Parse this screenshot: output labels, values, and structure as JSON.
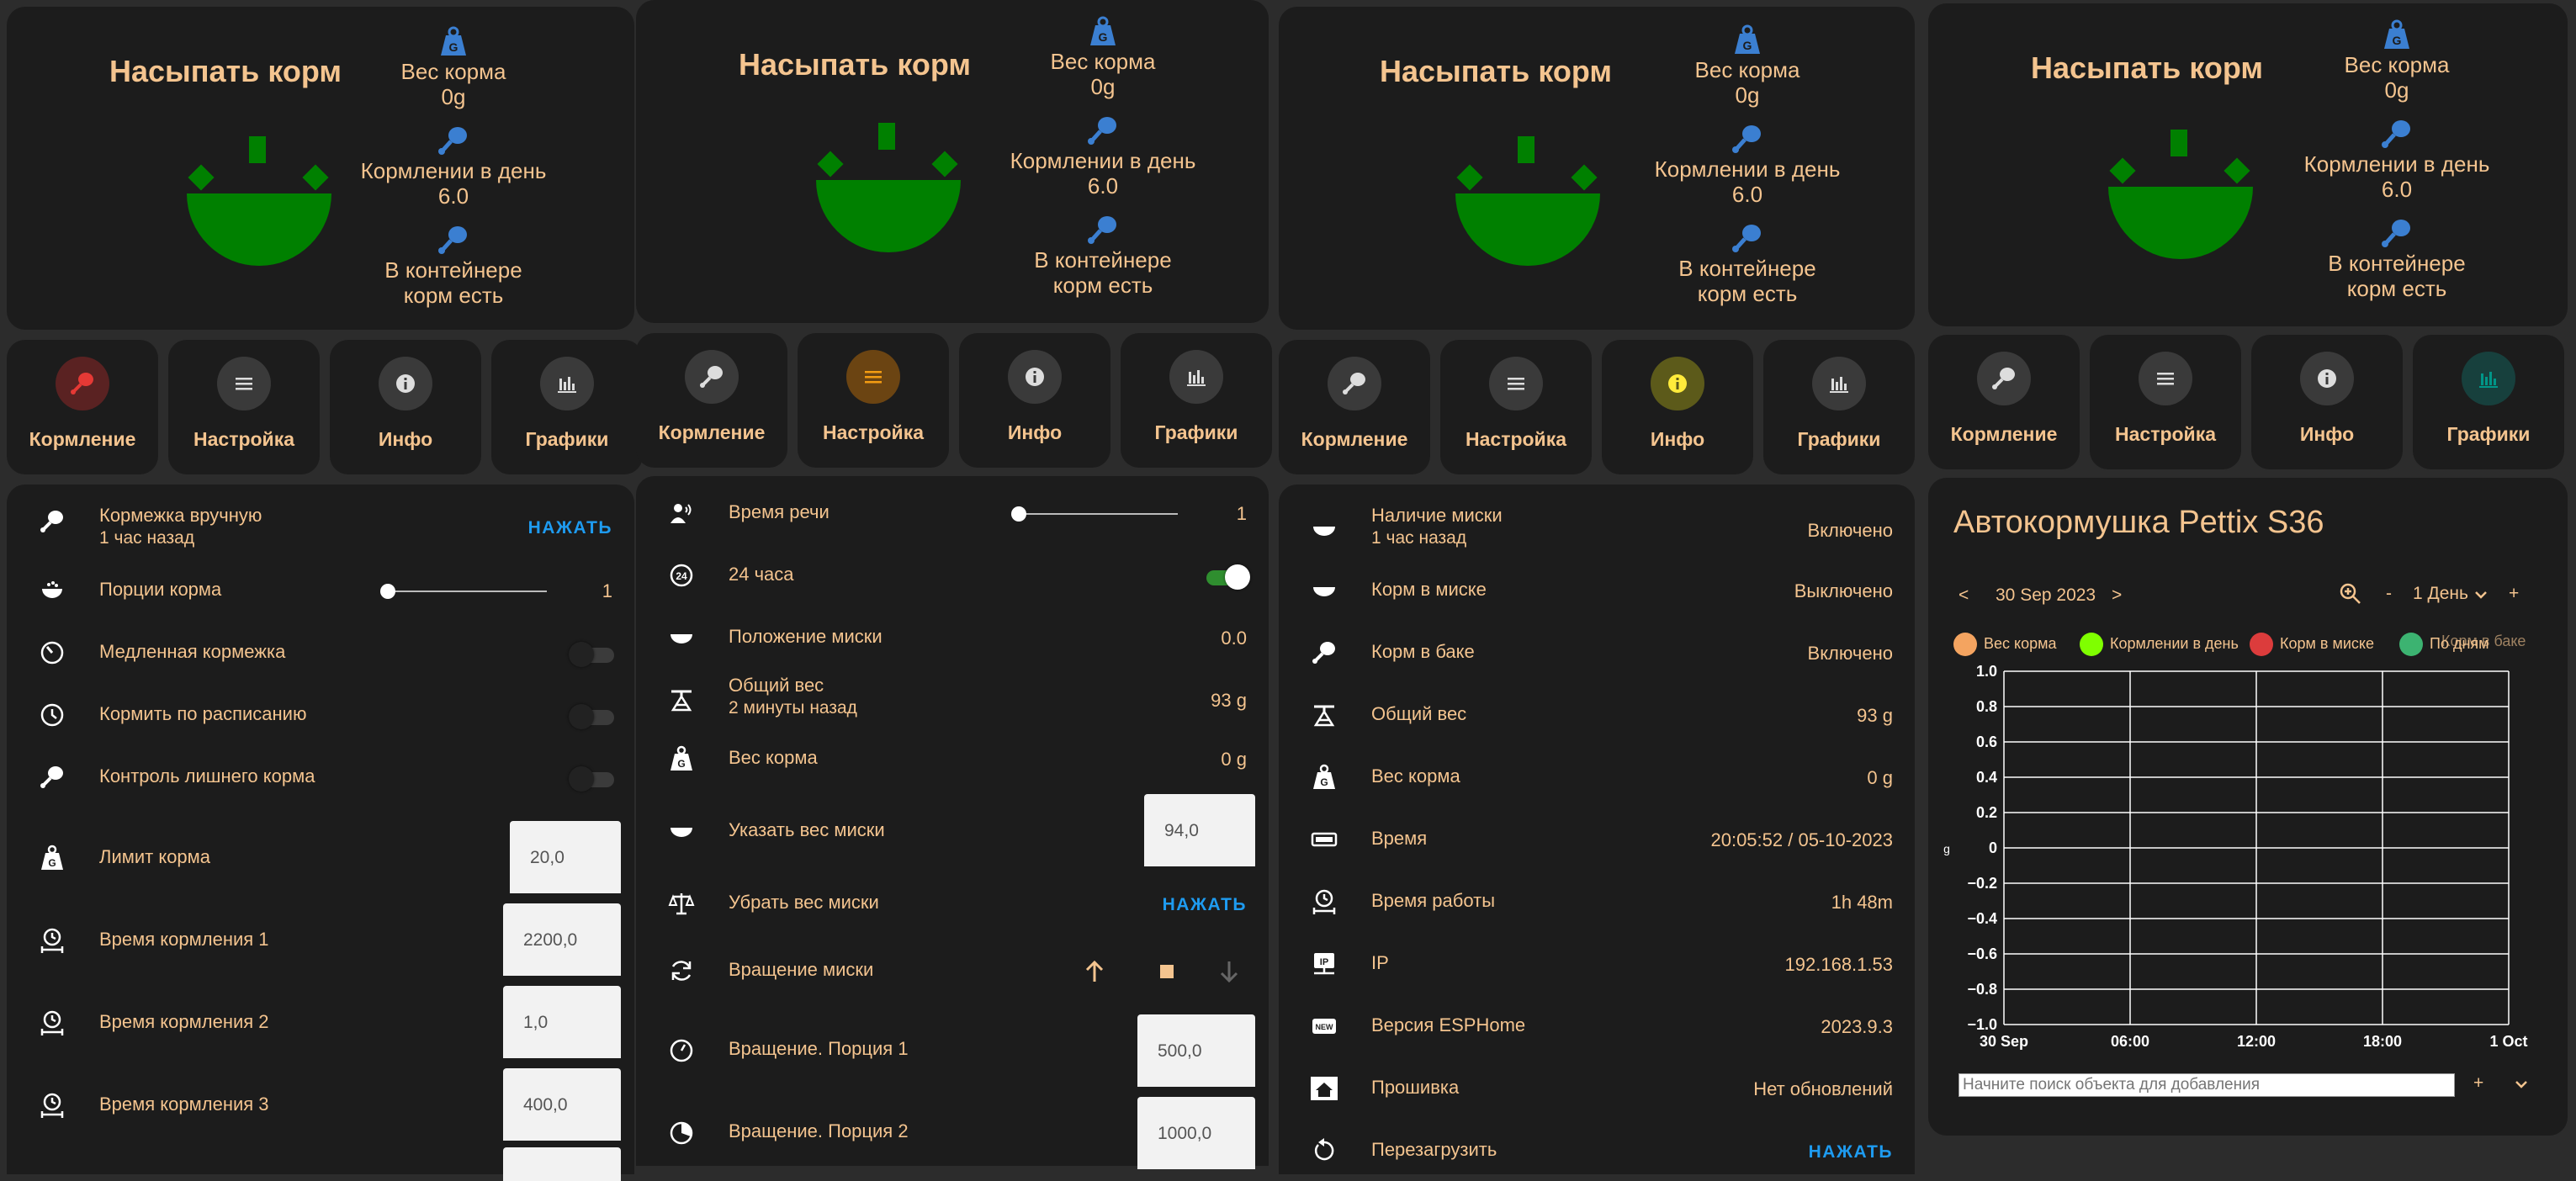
{
  "colors": {
    "accent": "#f4c48f",
    "card": "#1c1c1c",
    "bg": "#2c2c2c",
    "green": "#008000",
    "blue": "#1e9bf0",
    "icon_blue": "#3b7fd1"
  },
  "hero": {
    "title": "Насыпать корм",
    "stat1_label": "Вес корма",
    "stat1_value": "0g",
    "stat2_label": "Кормлении в день",
    "stat2_value": "6.0",
    "stat3_label": "В контейнере",
    "stat3_value": "корм есть"
  },
  "tabs": [
    "Кормление",
    "Настройка",
    "Инфо",
    "Графики"
  ],
  "feeding": {
    "manual_label": "Кормежка вручную",
    "manual_time": "1 час назад",
    "press": "НАЖАТЬ",
    "portions_label": "Порции корма",
    "portions_value": "1",
    "slow_label": "Медленная кормежка",
    "schedule_label": "Кормить по расписанию",
    "excess_label": "Контроль лишнего корма",
    "limit_label": "Лимит корма",
    "limit_value": "20,0",
    "time1_label": "Время кормления 1",
    "time1_value": "2200,0",
    "time2_label": "Время кормления 2",
    "time2_value": "1,0",
    "time3_label": "Время кормления 3",
    "time3_value": "400,0"
  },
  "settings": {
    "speech_label": "Время речи",
    "speech_value": "1",
    "h24_label": "24 часа",
    "bowl_pos_label": "Положение миски",
    "bowl_pos_value": "0.0",
    "total_label": "Общий вес",
    "total_time": "2 минуты назад",
    "total_value": "93 g",
    "feed_weight_label": "Вес корма",
    "feed_weight_value": "0 g",
    "set_bowl_label": "Указать вес миски",
    "set_bowl_value": "94,0",
    "remove_bowl_label": "Убрать вес миски",
    "press": "НАЖАТЬ",
    "rotate_label": "Вращение миски",
    "rot1_label": "Вращение. Порция 1",
    "rot1_value": "500,0",
    "rot2_label": "Вращение. Порция 2",
    "rot2_value": "1000,0"
  },
  "info": {
    "bowl_presence_label": "Наличие миски",
    "bowl_presence_time": "1 час назад",
    "bowl_presence_value": "Включено",
    "feed_in_bowl_label": "Корм в миске",
    "feed_in_bowl_value": "Выключено",
    "feed_in_tank_label": "Корм в баке",
    "feed_in_tank_value": "Включено",
    "total_label": "Общий вес",
    "total_value": "93 g",
    "feed_weight_label": "Вес корма",
    "feed_weight_value": "0 g",
    "time_label": "Время",
    "time_value": "20:05:52 / 05-10-2023",
    "uptime_label": "Время работы",
    "uptime_value": "1h 48m",
    "ip_label": "IP",
    "ip_value": "192.168.1.53",
    "esphome_label": "Версия ESPHome",
    "esphome_value": "2023.9.3",
    "fw_label": "Прошивка",
    "fw_value": "Нет обновлений",
    "reboot_label": "Перезагрузить",
    "press": "НАЖАТЬ"
  },
  "graphs": {
    "title": "Автокормушка Pettix S36",
    "date": "30 Sep 2023",
    "range": "1 День",
    "search_placeholder": "Начните поиск объекта для добавления",
    "legend": [
      {
        "name": "Вес корма",
        "color": "#f4a460"
      },
      {
        "name": "Кормлении в день",
        "color": "#7fff00"
      },
      {
        "name": "Корм в миске",
        "color": "#dc3c3c"
      },
      {
        "name": "По дням",
        "color": "#3cb371"
      },
      {
        "name": "Корм в баке",
        "color": "#f4c48f"
      }
    ]
  },
  "chart_data": {
    "type": "line",
    "x": [
      "30 Sep",
      "06:00",
      "12:00",
      "18:00",
      "1 Oct"
    ],
    "yticks": [
      "1.0",
      "0.8",
      "0.6",
      "0.4",
      "0.2",
      "0",
      "−0.2",
      "−0.4",
      "−0.6",
      "−0.8",
      "−1.0"
    ],
    "ylim": [
      -1.0,
      1.0
    ],
    "ylabel": "g",
    "grid": true,
    "legend_placement": "top",
    "series": []
  }
}
